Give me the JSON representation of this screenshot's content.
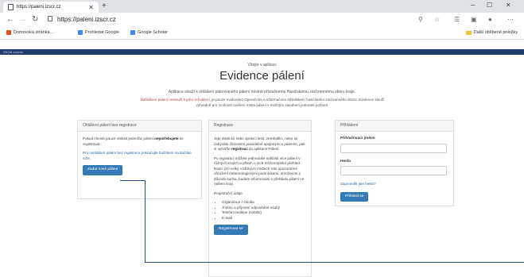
{
  "browser": {
    "tab_title": "https://paleni.izscr.cz",
    "new_tab": "+",
    "url": "https://paleni.izscr.cz",
    "bookmarks": [
      {
        "label": "Domovská stránka...",
        "icon": "office-icon",
        "color": "#e64a19"
      },
      {
        "label": "Prohledat Google",
        "icon": "bookmark-icon",
        "color": "#4285f4"
      },
      {
        "label": "Google Scholar",
        "icon": "scholar-icon",
        "color": "#4285f4"
      }
    ],
    "other_bookmarks": "Další oblíbené položky"
  },
  "appbar": {
    "label": "SSOB ovocze"
  },
  "header": {
    "welcome": "Vítejte v aplikaci",
    "title": "Evidence pálení",
    "intro1": "Aplikace slouží k ohlášení plánovaného pálení místně příslušnému Hasičskému záchrannému sboru kraje.",
    "intro2_red": "Nahlášení pálení neslouží k jeho schválení",
    "intro2_rest": ", je pouze evidováno Operačním a informačním střediskem hasičského záchranného sboru. Evidence slouží výhradně pro možnost ověření místa pálení s možným zásahem jednotek požární."
  },
  "panels": {
    "left": {
      "heading": "Ohlášení pálení bez registrace",
      "p1_pre": "Pokud chcete pouze ohlásit jednořáz pálení ",
      "p1_bold": "nepotřebujete",
      "p1_post": " se registrovat.",
      "p2": "Pro nahlášení pálení bez registrace pokračujte tlačítkem na tlačítko níže.",
      "button": "Zadat nové pálení"
    },
    "middle": {
      "heading": "Registrace",
      "p1_pre": "Jste vlastníci nebo správci lesů, zemědělci, nebo se zabýváte činnostmi pravidelně spojenými s pálením, pak si vytvořte ",
      "p1_bold": "registraci",
      "p1_post": " do aplikace Pálení.",
      "p2": "Po registraci můžete jednoduše nahlásit více pálení v různých krajích a přitom o nich mít kompletní přehled. Navíc pro velký v blízkých místech Vás upozorníme ohrožení meteorologickými podmínkami, ohrožením z důvodu sucha, budete informováni o přehledu pálení ve Vašem kraji.",
      "reg_label": "Registrační údaje",
      "items": [
        "Organizace / Osoba",
        "Jméno a příjmení odpovědné osoby",
        "Telefon (nejlépe mobilní)",
        "E-mail"
      ],
      "button": "Registrovat se"
    },
    "right": {
      "heading": "Přihlášení",
      "username_label": "Přihlašovací jméno",
      "password_label": "Heslo",
      "forgot": "Zapomněli jste heslo?",
      "button": "Přihlásit se"
    }
  },
  "colors": {
    "primary": "#337ab7",
    "appbar": "#1f3d6b",
    "warning": "#a94442"
  }
}
